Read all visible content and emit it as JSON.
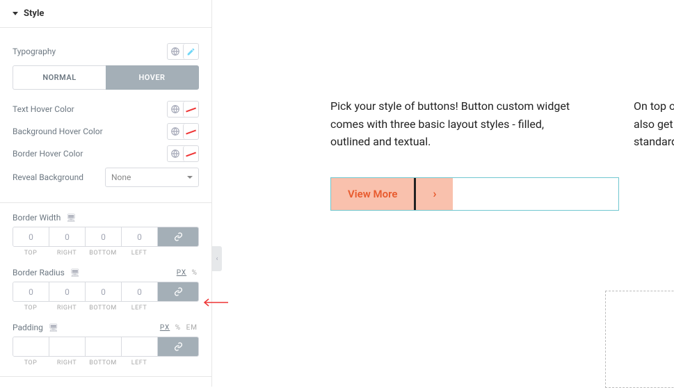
{
  "section": {
    "title": "Style"
  },
  "typography": {
    "label": "Typography"
  },
  "tabs": {
    "normal": "NORMAL",
    "hover": "HOVER"
  },
  "hover": {
    "text_color": "Text Hover Color",
    "bg_color": "Background Hover Color",
    "border_color": "Border Hover Color",
    "reveal_bg": "Reveal Background",
    "reveal_value": "None"
  },
  "border_width": {
    "label": "Border Width",
    "top": "0",
    "right": "0",
    "bottom": "0",
    "left": "0",
    "lbls": [
      "TOP",
      "RIGHT",
      "BOTTOM",
      "LEFT"
    ]
  },
  "border_radius": {
    "label": "Border Radius",
    "top": "0",
    "right": "0",
    "bottom": "0",
    "left": "0",
    "lbls": [
      "TOP",
      "RIGHT",
      "BOTTOM",
      "LEFT"
    ],
    "units": [
      "PX",
      "%"
    ]
  },
  "padding": {
    "label": "Padding",
    "top": "",
    "right": "",
    "bottom": "",
    "left": "",
    "lbls": [
      "TOP",
      "RIGHT",
      "BOTTOM",
      "LEFT"
    ],
    "units": [
      "PX",
      "%",
      "EM"
    ]
  },
  "preview": {
    "para": "Pick your style of buttons! Button custom widget comes with three basic layout styles - filled, outlined and textual.",
    "para2_line1": "On top of",
    "para2_line2": "also get",
    "para2_line3": "standard",
    "button": "View More",
    "button_icon": "›"
  }
}
